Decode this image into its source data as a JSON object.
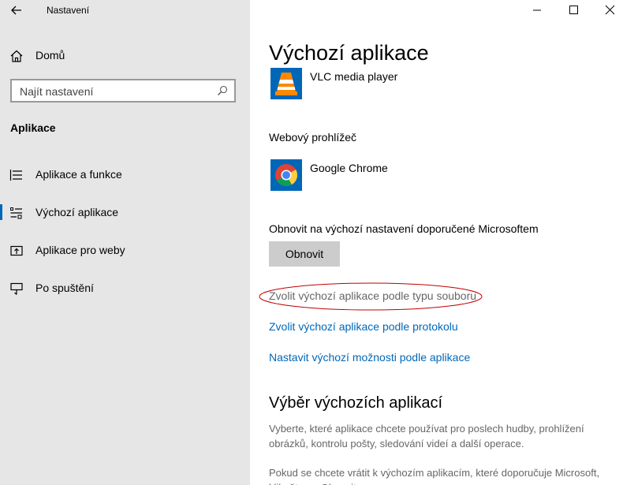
{
  "window": {
    "title": "Nastavení"
  },
  "sidebar": {
    "home_label": "Domů",
    "search_placeholder": "Najít nastavení",
    "section_title": "Aplikace",
    "items": [
      {
        "label": "Aplikace a funkce"
      },
      {
        "label": "Výchozí aplikace"
      },
      {
        "label": "Aplikace pro weby"
      },
      {
        "label": "Po spuštění"
      }
    ]
  },
  "main": {
    "title": "Výchozí aplikace",
    "video_app": "VLC media player",
    "browser_label": "Webový prohlížeč",
    "browser_app": "Google Chrome",
    "reset_label": "Obnovit na výchozí nastavení doporučené Microsoftem",
    "reset_button": "Obnovit",
    "link_file_type": "Zvolit výchozí aplikace podle typu souboru",
    "link_protocol": "Zvolit výchozí aplikace podle protokolu",
    "link_app_defaults": "Nastavit výchozí možnosti podle aplikace",
    "section_title": "Výběr výchozích aplikací",
    "desc1": "Vyberte, které aplikace chcete používat pro poslech hudby, prohlížení obrázků, kontrolu pošty, sledování videí a další operace.",
    "desc2": "Pokud se chcete vrátit k výchozím aplikacím, které doporučuje Microsoft, klikněte na Obnovit."
  },
  "colors": {
    "sidebar_bg": "#e6e6e6",
    "accent": "#0067b8",
    "annotation": "#c00000"
  }
}
